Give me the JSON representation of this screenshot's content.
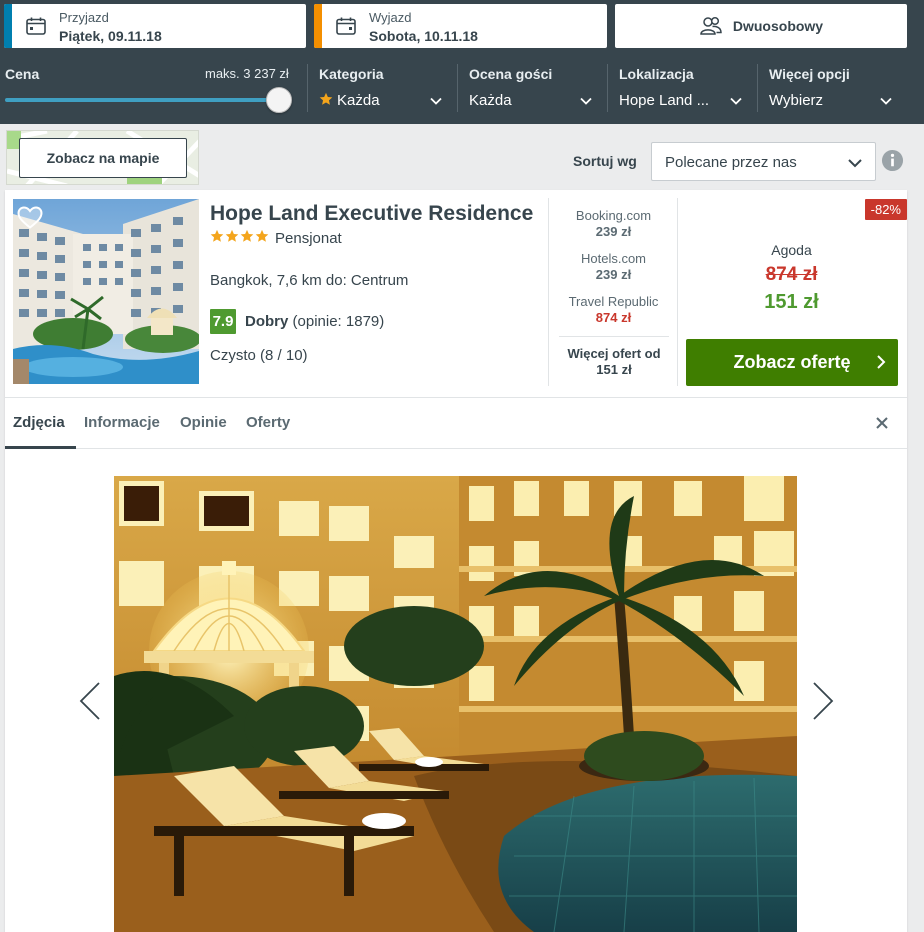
{
  "search": {
    "checkin": {
      "label": "Przyjazd",
      "value": "Piątek, 09.11.18"
    },
    "checkout": {
      "label": "Wyjazd",
      "value": "Sobota, 10.11.18"
    },
    "room": {
      "label": "Dwuosobowy"
    }
  },
  "filters": {
    "price": {
      "label": "Cena",
      "max_label": "maks. 3 237 zł",
      "slider_fraction": 1.0
    },
    "category": {
      "label": "Kategoria",
      "value": "Każda"
    },
    "guest_rating": {
      "label": "Ocena gości",
      "value": "Każda"
    },
    "location": {
      "label": "Lokalizacja",
      "value": "Hope Land ..."
    },
    "more": {
      "label": "Więcej opcji",
      "value": "Wybierz"
    }
  },
  "map": {
    "button_label": "Zobacz na mapie"
  },
  "sort": {
    "label": "Sortuj wg",
    "value": "Polecane przez nas"
  },
  "hotel": {
    "name": "Hope Land Executive Residence",
    "stars": 4,
    "type": "Pensjonat",
    "location": "Bangkok, 7,6 km do: Centrum",
    "rating_score": "7.9",
    "rating_word": "Dobry",
    "rating_count": "(opinie: 1879)",
    "cleanliness": "Czysto (8 / 10)",
    "offers": [
      {
        "site": "Booking.com",
        "price": "239 zł"
      },
      {
        "site": "Hotels.com",
        "price": "239 zł"
      },
      {
        "site": "Travel Republic",
        "price": "874 zł"
      }
    ],
    "more_offers": "Więcej ofert od",
    "more_offers_price": "151 zł",
    "discount": "-82%",
    "best_site": "Agoda",
    "old_price": "874 zł",
    "new_price": "151 zł",
    "deal_button": "Zobacz ofertę"
  },
  "tabs": [
    {
      "label": "Zdjęcia"
    },
    {
      "label": "Informacje"
    },
    {
      "label": "Opinie"
    },
    {
      "label": "Oferty"
    }
  ],
  "colors": {
    "header_bg": "#37454d",
    "checkin_accent": "#007faf",
    "checkout_accent": "#f48f00",
    "deal_green": "#3f7e00",
    "price_red": "#c9372c",
    "rating_green": "#4f9a30"
  },
  "icons": {
    "checkin": "calendar-icon",
    "checkout": "calendar-icon",
    "room": "users-icon",
    "info": "info-icon",
    "favorite": "heart-icon",
    "close": "close-icon",
    "dropdown": "chevron-down-icon",
    "deal_arrow": "chevron-right-icon"
  }
}
